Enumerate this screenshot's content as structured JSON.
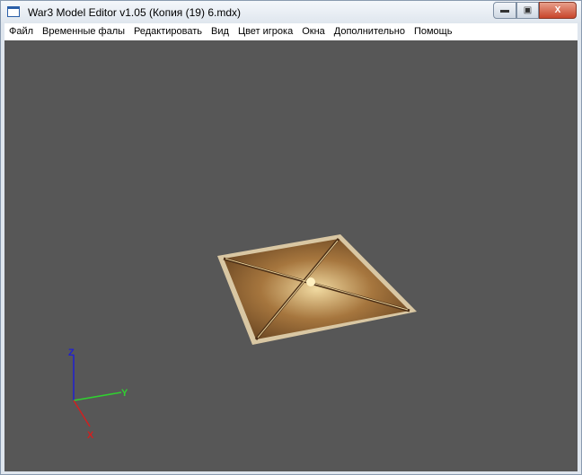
{
  "window": {
    "title": "War3 Model Editor v1.05 (Копия (19) 6.mdx)",
    "icon": "window-icon",
    "controls": {
      "minimize": "minimize-icon",
      "maximize": "maximize-icon",
      "close": "close-icon"
    }
  },
  "menu": [
    "Файл",
    "Временные фалы",
    "Редактировать",
    "Вид",
    "Цвет игрока",
    "Окна",
    "Дополнительно",
    "Помощь"
  ],
  "viewport": {
    "background": "#575757",
    "axes": {
      "x": "X",
      "y": "Y",
      "z": "Z",
      "x_color": "#d02020",
      "y_color": "#30d030",
      "z_color": "#2020d0"
    }
  }
}
